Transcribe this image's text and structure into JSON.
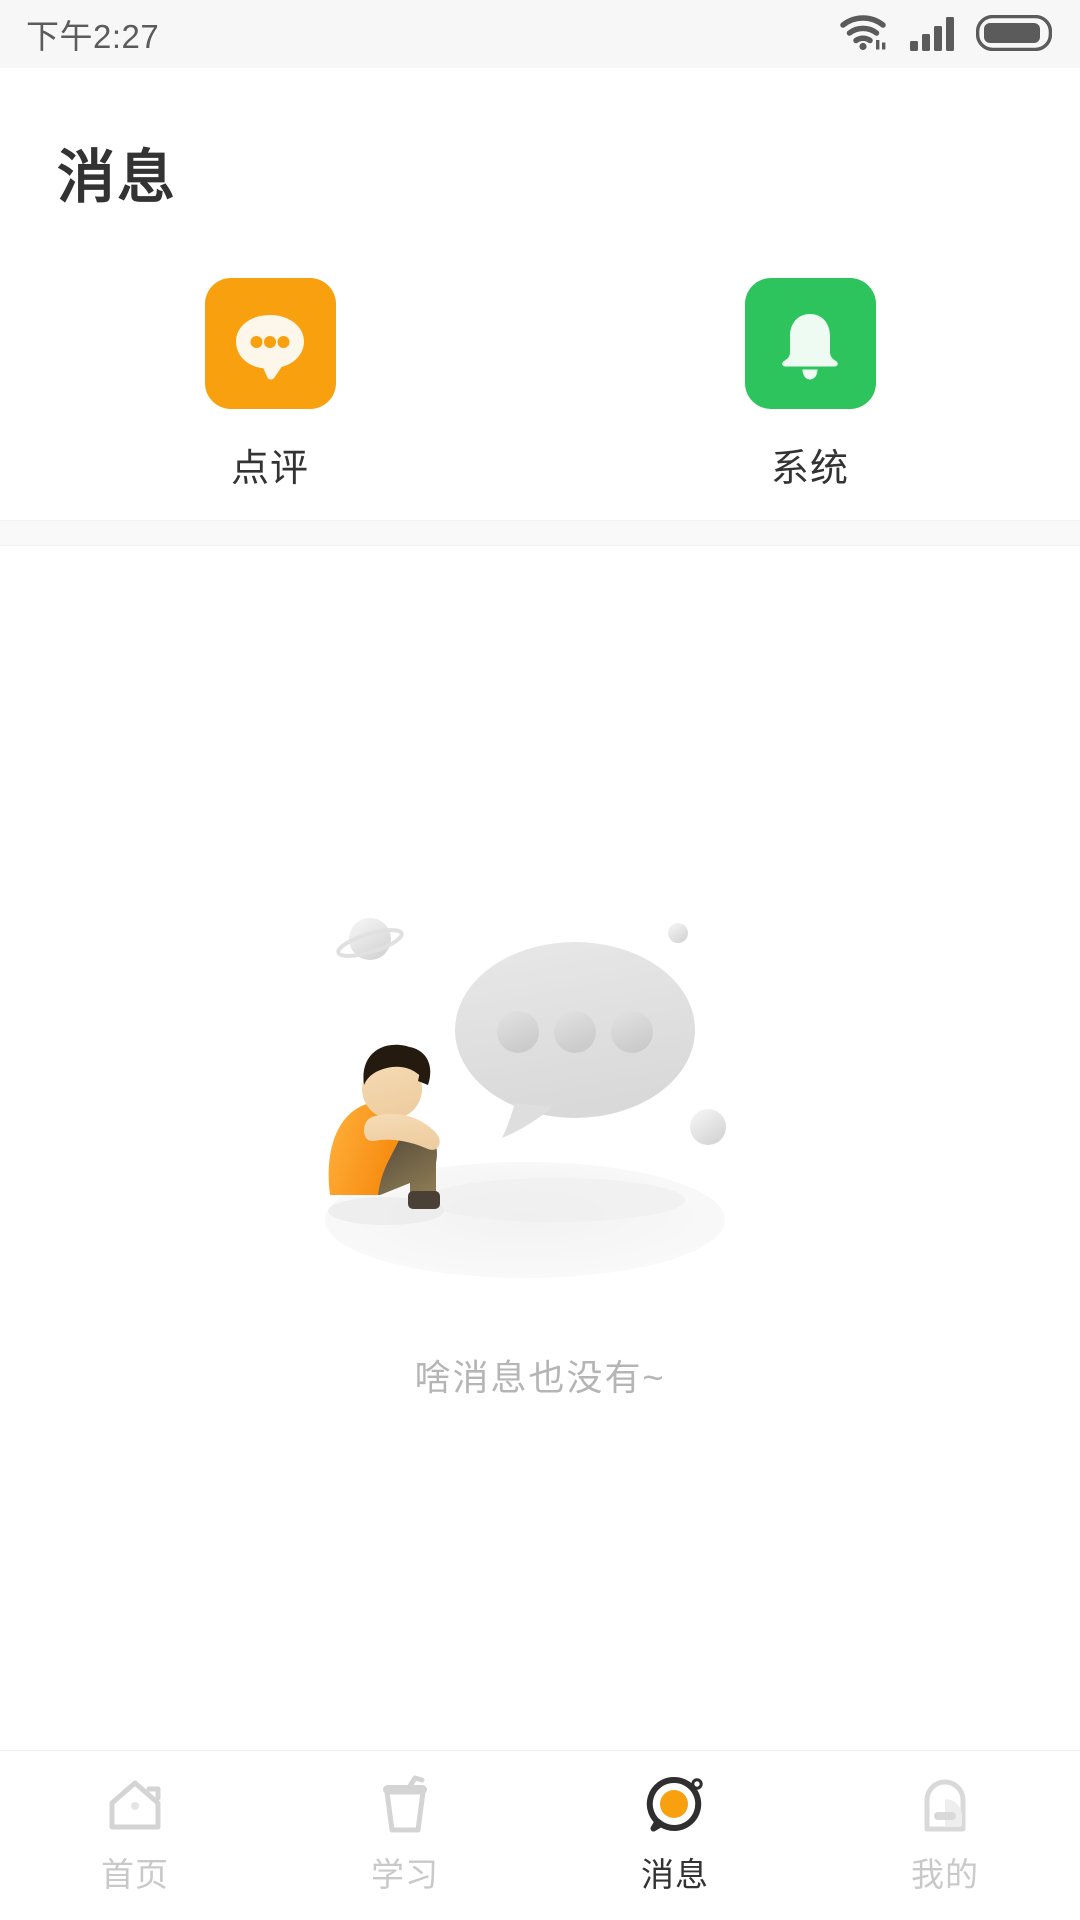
{
  "status_bar": {
    "time": "下午2:27",
    "icons": [
      "wifi-icon",
      "cellular-signal-icon",
      "battery-icon"
    ]
  },
  "header": {
    "title": "消息",
    "entries": [
      {
        "label": "点评",
        "icon": "chat-bubble-icon",
        "color": "#f8a00d"
      },
      {
        "label": "系统",
        "icon": "bell-icon",
        "color": "#2dc45e"
      }
    ]
  },
  "empty_state": {
    "illustration": "sad-person-empty-chat-illustration",
    "text": "啥消息也没有~"
  },
  "tabbar": {
    "items": [
      {
        "label": "首页",
        "icon": "home-icon",
        "active": false
      },
      {
        "label": "学习",
        "icon": "cup-icon",
        "active": false
      },
      {
        "label": "消息",
        "icon": "message-bubble-icon",
        "active": true
      },
      {
        "label": "我的",
        "icon": "profile-card-icon",
        "active": false
      }
    ]
  },
  "colors": {
    "accent_orange": "#f8a00d",
    "accent_green": "#2dc45e",
    "text_primary": "#333333",
    "text_muted": "#b5b5b5",
    "tab_inactive": "#c9c9c9",
    "page_bg": "#ffffff",
    "divider_bg": "#f9f9f9"
  }
}
